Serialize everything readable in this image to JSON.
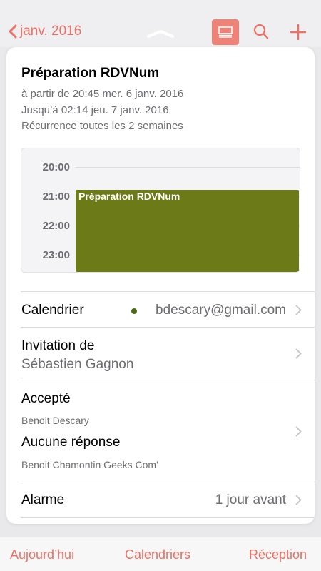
{
  "nav": {
    "back_label": "janv. 2016",
    "colors": {
      "accent": "#ee6f63",
      "accent_button": "#ee8277"
    }
  },
  "event": {
    "title": "Préparation RDVNum",
    "start": "à partir de 20:45 mer. 6 janv. 2016",
    "end": "Jusqu’à 02:14 jeu. 7 janv. 2016",
    "recurrence": "Récurrence toutes les 2 semaines",
    "block_label": "Préparation RDVNum",
    "color": "#6c7a17"
  },
  "day_view": {
    "hours": [
      "20:00",
      "21:00",
      "22:00",
      "23:00"
    ]
  },
  "details": {
    "calendar_label": "Calendrier",
    "calendar_value": "bdescary@gmail.com",
    "calendar_dot_color": "#4e6b14",
    "invitation_label": "Invitation de",
    "invitation_value": "Sébastien Gagnon",
    "accepted_label": "Accepté",
    "accepted_person": "Benoit Descary",
    "no_response_label": "Aucune réponse",
    "no_response_person": "Benoit Chamontin Geeks Com'",
    "alarm_label": "Alarme",
    "alarm_value": "1 jour avant"
  },
  "tabbar": {
    "today": "Aujourd’hui",
    "calendars": "Calendriers",
    "inbox": "Réception"
  },
  "icons": [
    "chevron-left-icon",
    "collapse-handle-icon",
    "list-view-icon",
    "search-icon",
    "plus-icon",
    "chevron-right-icon"
  ]
}
